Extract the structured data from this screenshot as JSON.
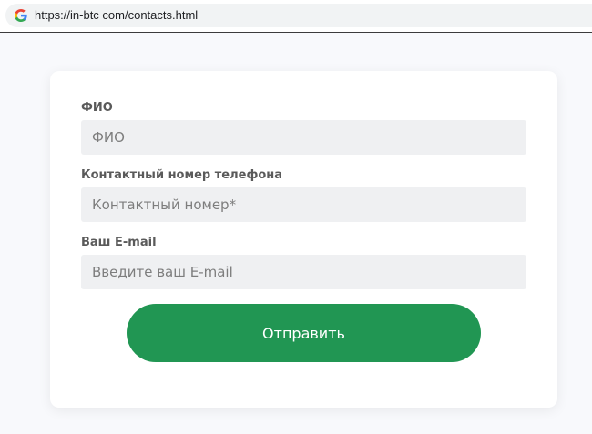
{
  "browser": {
    "url": "https://in-btc com/contacts.html",
    "favicon_icon": "google-g-icon"
  },
  "form": {
    "fields": [
      {
        "label": "ФИО",
        "placeholder": "ФИО"
      },
      {
        "label": "Контактный номер телефона",
        "placeholder": "Контактный номер*"
      },
      {
        "label": "Ваш E-mail",
        "placeholder": "Введите ваш E-mail"
      }
    ],
    "submit_label": "Отправить"
  },
  "colors": {
    "accent": "#219653",
    "input_background": "#eff0f2",
    "page_background": "#f8f9fc"
  }
}
